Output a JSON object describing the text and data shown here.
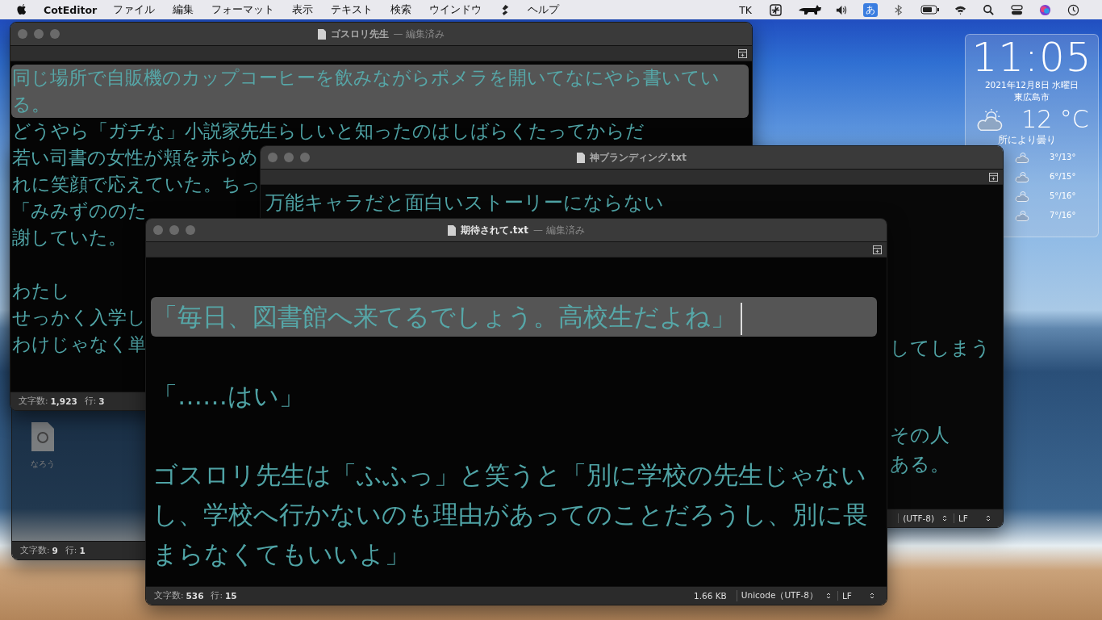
{
  "menu_bar": {
    "app": "CotEditor",
    "menus": [
      "ファイル",
      "編集",
      "フォーマット",
      "表示",
      "テキスト",
      "検索",
      "ウインドウ",
      "ヘルプ"
    ],
    "user": "TK",
    "input_mode": "あ"
  },
  "widget": {
    "time": "11:05",
    "date": "2021年12月8日 水曜日",
    "city": "東広島市",
    "temperature": "12 °C",
    "condition": "所により曇り",
    "forecast": [
      {
        "temps": "3°/13°"
      },
      {
        "temps": "6°/15°"
      },
      {
        "temps": "5°/16°"
      },
      {
        "temps": "7°/16°"
      }
    ]
  },
  "desktop_icons": [
    {
      "label": "なろう"
    }
  ],
  "windows": [
    {
      "active": false,
      "title": "ゴスロリ先生",
      "document_state": "— 編集済み",
      "lines": [
        {
          "kind": "text",
          "highlighted": true,
          "text": "同じ場所で自販機のカップコーヒーを飲みながらポメラを開いてなにやら書いている。"
        },
        {
          "kind": "text",
          "highlighted": false,
          "text": "どうやら「ガチな」小説家先生らしいと知ったのはしばらくたってからだ"
        },
        {
          "kind": "text",
          "highlighted": false,
          "text": "若い司書の女性が頬を赤らめ"
        },
        {
          "kind": "text",
          "highlighted": false,
          "text": "れに笑顔で応えていた。ちっ"
        },
        {
          "kind": "text",
          "highlighted": false,
          "text": "「みみずののた"
        },
        {
          "kind": "text",
          "highlighted": false,
          "text": "謝していた。"
        },
        {
          "kind": "blank"
        },
        {
          "kind": "text",
          "highlighted": false,
          "text": "わたし"
        },
        {
          "kind": "text",
          "highlighted": false,
          "text": "せっかく入学し"
        },
        {
          "kind": "text",
          "highlighted": false,
          "text": "わけじゃなく単"
        }
      ],
      "status": {
        "char_count_label": "文字数:",
        "char_count": "1,923",
        "line_label": "行:",
        "line": "3"
      }
    },
    {
      "active": false,
      "status": {
        "char_count_label": "文字数:",
        "char_count": "9",
        "line_label": "行:",
        "line": "1"
      }
    },
    {
      "active": false,
      "title": "神ブランディング.txt",
      "lines": [
        {
          "kind": "text",
          "highlighted": false,
          "text": "万能キャラだと面白いストーリーにならない"
        },
        {
          "kind": "blank"
        },
        {
          "kind": "blank"
        },
        {
          "kind": "blank"
        },
        {
          "kind": "blank"
        },
        {
          "kind": "fragment",
          "highlighted": false,
          "text": "してしまう"
        },
        {
          "kind": "blank"
        },
        {
          "kind": "blank"
        },
        {
          "kind": "fragment",
          "highlighted": false,
          "text": "その人"
        },
        {
          "kind": "fragment",
          "highlighted": false,
          "text": "ある。"
        }
      ],
      "status": {
        "encoding": "(UTF-8)",
        "line_ending": "LF"
      }
    },
    {
      "active": true,
      "title": "期待されて.txt",
      "document_state": "— 編集済み",
      "lines": [
        {
          "kind": "blank"
        },
        {
          "kind": "text",
          "highlighted": true,
          "text": "「毎日、図書館へ来てるでしょう。高校生だよね」"
        },
        {
          "kind": "blank"
        },
        {
          "kind": "text",
          "highlighted": false,
          "text": "「……はい」"
        },
        {
          "kind": "blank"
        },
        {
          "kind": "text",
          "highlighted": false,
          "text": "ゴスロリ先生は「ふふっ」と笑うと「別に学校の先生じゃないし、学校へ行かないのも理由があってのことだろうし、別に畏まらなくてもいいよ」"
        }
      ],
      "status": {
        "char_count_label": "文字数:",
        "char_count": "536",
        "line_label": "行:",
        "line": "15",
        "file_size": "1.66 KB",
        "encoding": "Unicode（UTF-8）",
        "line_ending": "LF"
      }
    }
  ]
}
